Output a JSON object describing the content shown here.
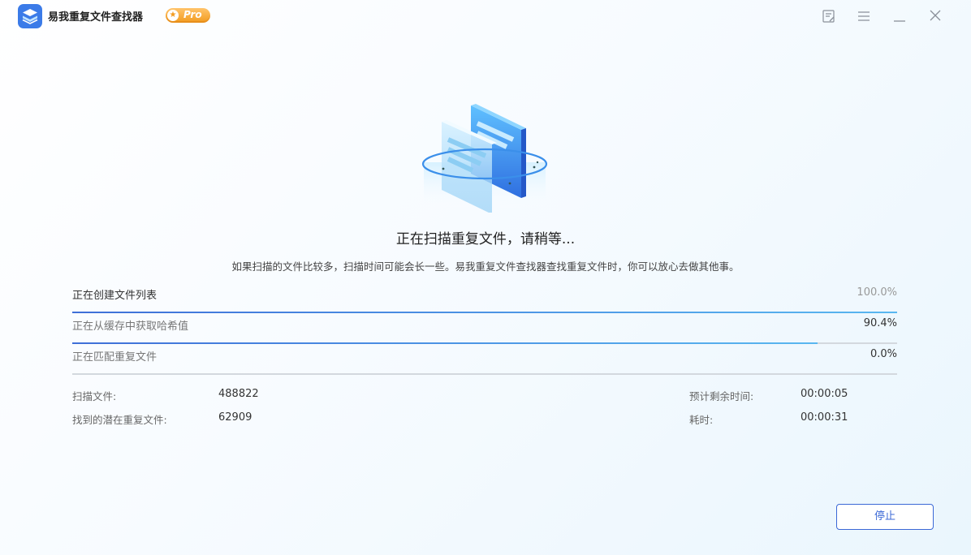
{
  "app": {
    "title": "易我重复文件查找器",
    "badge": "Pro"
  },
  "window_controls": {
    "icons": [
      "feedback-icon",
      "menu-icon",
      "minimize-icon",
      "close-icon"
    ]
  },
  "main": {
    "heading": "正在扫描重复文件，请稍等...",
    "subheading": "如果扫描的文件比较多，扫描时间可能会长一些。易我重复文件查找器查找重复文件时，你可以放心去做其他事。"
  },
  "progress": [
    {
      "label": "正在创建文件列表",
      "value": "100.0%",
      "fraction": 1.0,
      "state": "done"
    },
    {
      "label": "正在从缓存中获取哈希值",
      "value": "90.4%",
      "fraction": 0.904,
      "state": "active"
    },
    {
      "label": "正在匹配重复文件",
      "value": "0.0%",
      "fraction": 0.0,
      "state": "pending"
    }
  ],
  "stats": {
    "scanned_label": "扫描文件:",
    "scanned_value": "488822",
    "found_label": "找到的潜在重复文件:",
    "found_value": "62909",
    "remaining_label": "预计剩余时间:",
    "remaining_value": "00:00:05",
    "elapsed_label": "耗时:",
    "elapsed_value": "00:00:31"
  },
  "buttons": {
    "stop": "停止"
  },
  "colors": {
    "accent": "#3b68d6",
    "progress_start": "#3f6fd8",
    "progress_end": "#59b7f0",
    "badge": "#f5a52a"
  }
}
